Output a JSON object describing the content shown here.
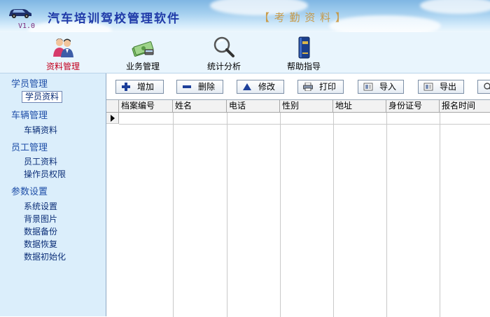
{
  "header": {
    "version": "V1.0",
    "app_title": "汽车培训驾校管理软件",
    "module_title": "【 考 勤 资 料 】"
  },
  "toolbar": {
    "items": [
      {
        "label": "资料管理",
        "icon": "people-icon",
        "active": true
      },
      {
        "label": "业务管理",
        "icon": "money-icon"
      },
      {
        "label": "统计分析",
        "icon": "magnifier-icon"
      },
      {
        "label": "帮助指导",
        "icon": "book-icon"
      }
    ]
  },
  "sidebar": {
    "groups": [
      {
        "title": "学员管理",
        "items": [
          "学员资料"
        ]
      },
      {
        "title": "车辆管理",
        "items": [
          "车辆资料"
        ]
      },
      {
        "title": "员工管理",
        "items": [
          "员工资料",
          "操作员权限"
        ]
      },
      {
        "title": "参数设置",
        "items": [
          "系统设置",
          "背景图片",
          "数据备份",
          "数据恢复",
          "数据初始化"
        ]
      }
    ],
    "selected": "学员资料"
  },
  "actions": {
    "add": "增加",
    "delete": "删除",
    "edit": "修改",
    "print": "打印",
    "import": "导入",
    "export": "导出"
  },
  "grid": {
    "columns": [
      "档案编号",
      "姓名",
      "电话",
      "性别",
      "地址",
      "身份证号",
      "报名时间"
    ],
    "rows": []
  },
  "colors": {
    "title_blue": "#1f3aa8",
    "active_red": "#c3001e",
    "sidebar_bg": "#dbeefb",
    "toolbar_bg": "#e9f5fd"
  }
}
